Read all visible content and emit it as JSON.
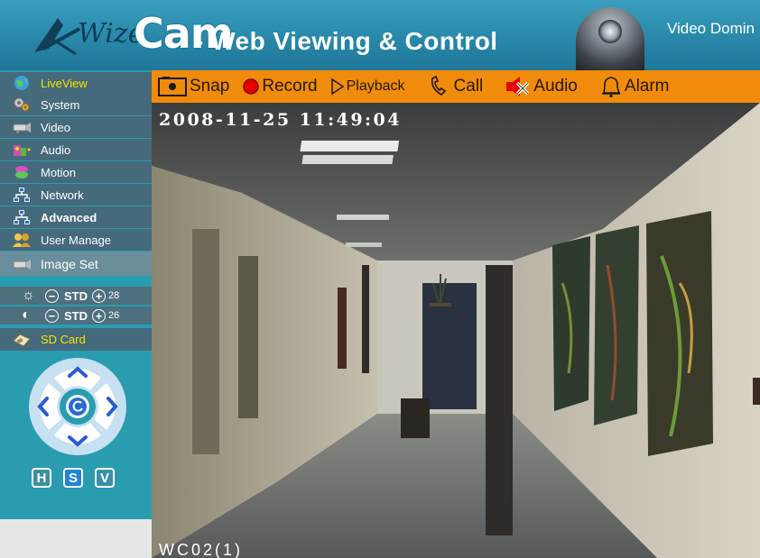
{
  "header": {
    "logo_wize": "Wize",
    "logo_cam": "Cam",
    "tagline": "- Web Viewing & Control",
    "brand": "Video Domin"
  },
  "sidebar": {
    "items": [
      {
        "label": "LiveView",
        "icon": "globe-icon",
        "active": true
      },
      {
        "label": "System",
        "icon": "gears-icon"
      },
      {
        "label": "Video",
        "icon": "camera-icon"
      },
      {
        "label": "Audio",
        "icon": "speaker-icon"
      },
      {
        "label": "Motion",
        "icon": "motion-icon"
      },
      {
        "label": "Network",
        "icon": "network-icon"
      },
      {
        "label": "Advanced",
        "icon": "network-advanced-icon"
      },
      {
        "label": "User Manage",
        "icon": "users-icon"
      },
      {
        "label": "Image Set",
        "icon": "camera-icon"
      }
    ],
    "brightness": {
      "mode": "STD",
      "value": "28"
    },
    "contrast": {
      "mode": "STD",
      "value": "26"
    },
    "sd_card": {
      "label": "SD Card",
      "icon": "sd-card-icon"
    },
    "ptz_buttons": [
      "H",
      "S",
      "V"
    ]
  },
  "toolbar": {
    "snap": "Snap",
    "record": "Record",
    "playback": "Playback",
    "call": "Call",
    "audio": "Audio",
    "alarm": "Alarm"
  },
  "video": {
    "timestamp": "2008-11-25  11:49:04",
    "camera_label": "WC02(1)"
  },
  "colors": {
    "header": "#2b8cae",
    "sidebar": "#2a9cb0",
    "toolbar": "#f08b0c",
    "active_nav": "#f6e400",
    "record": "#e80000"
  }
}
